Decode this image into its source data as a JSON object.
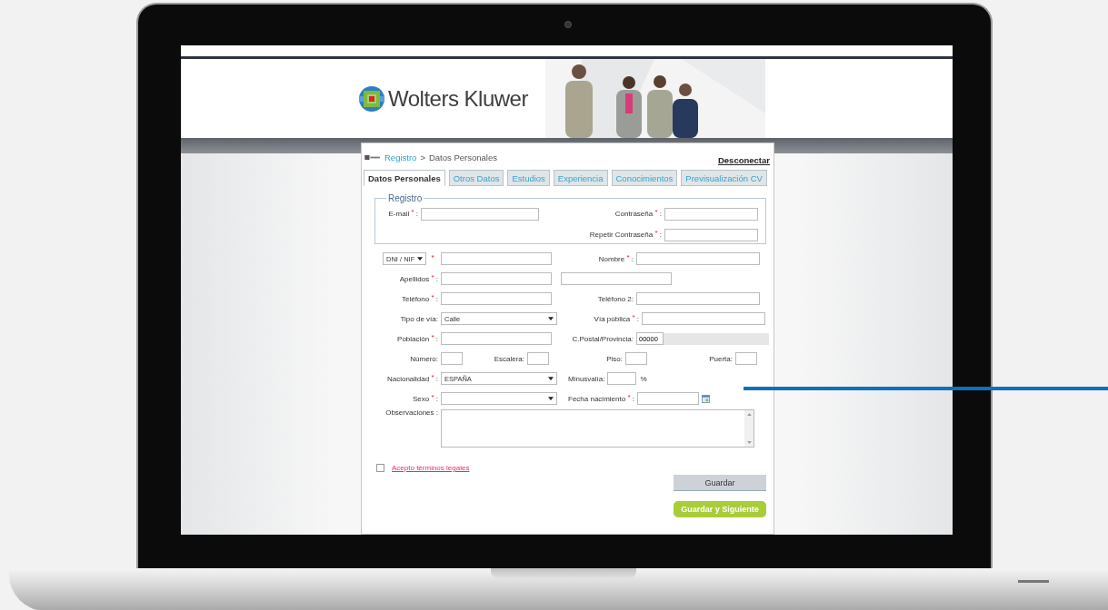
{
  "brand": "Wolters Kluwer",
  "breadcrumb": {
    "link": "Registro",
    "separator": ">",
    "current": "Datos Personales"
  },
  "logout": "Desconectar",
  "tabs": [
    {
      "label": "Datos Personales",
      "selected": true
    },
    {
      "label": "Otros Datos",
      "selected": false
    },
    {
      "label": "Estudios",
      "selected": false
    },
    {
      "label": "Experiencia",
      "selected": false
    },
    {
      "label": "Conocimientos",
      "selected": false
    },
    {
      "label": "Previsualización CV",
      "selected": false
    }
  ],
  "registro": {
    "legend": "Registro",
    "fields": [
      {
        "label": "E-mail $^{*}$ :"
      },
      {
        "label": "Contraseña $^{*}$ :"
      },
      {
        "label": "Repetir Contraseña $^{*}$ :"
      }
    ]
  },
  "rows": [
    [
      {
        "kind": "doc-select",
        "value": "DNI / NIF",
        "label": "$^{*}$"
      },
      {
        "kind": "text",
        "label": "Nombre $^{*}$ :"
      }
    ],
    [
      {
        "kind": "text",
        "label": "Apellidos $^{*}$ :"
      },
      {
        "kind": "text-extra"
      }
    ],
    [
      {
        "kind": "text",
        "label": "Teléfono $^{*}$ :"
      },
      {
        "kind": "text",
        "label": "Teléfono 2:"
      }
    ],
    [
      {
        "kind": "select",
        "label": "Tipo de vía:",
        "value": "Calle"
      },
      {
        "kind": "text",
        "label": "Vía pública $^{*}$ :"
      }
    ],
    [
      {
        "kind": "text",
        "label": "Población $^{*}$ :"
      },
      {
        "kind": "postal",
        "label": "C.Postal/Provincia:",
        "value": "00000"
      }
    ],
    [
      {
        "kind": "small",
        "label": "Número:"
      },
      {
        "kind": "small",
        "label": "Escalera:"
      },
      {
        "kind": "small",
        "label": "Piso:"
      },
      {
        "kind": "small",
        "label": "Puerta:"
      }
    ],
    [
      {
        "kind": "select",
        "label": "Nacionalidad $^{*}$ :",
        "value": "ESPAÑA"
      },
      {
        "kind": "percent",
        "label": "Minusvalía:",
        "unit": "%"
      }
    ],
    [
      {
        "kind": "select",
        "label": "Sexo $^{*}$ :"
      },
      {
        "kind": "date",
        "label": "Fecha nacimiento $^{*}$ :"
      }
    ],
    [
      {
        "kind": "textarea",
        "label": "Observaciones :"
      }
    ]
  ],
  "terms": {
    "label": "Acepto términos legales",
    "checked": false
  },
  "buttons": [
    {
      "label": "Guardar",
      "kind": "secondary"
    },
    {
      "label": "Guardar y Siguiente",
      "kind": "primary"
    }
  ]
}
